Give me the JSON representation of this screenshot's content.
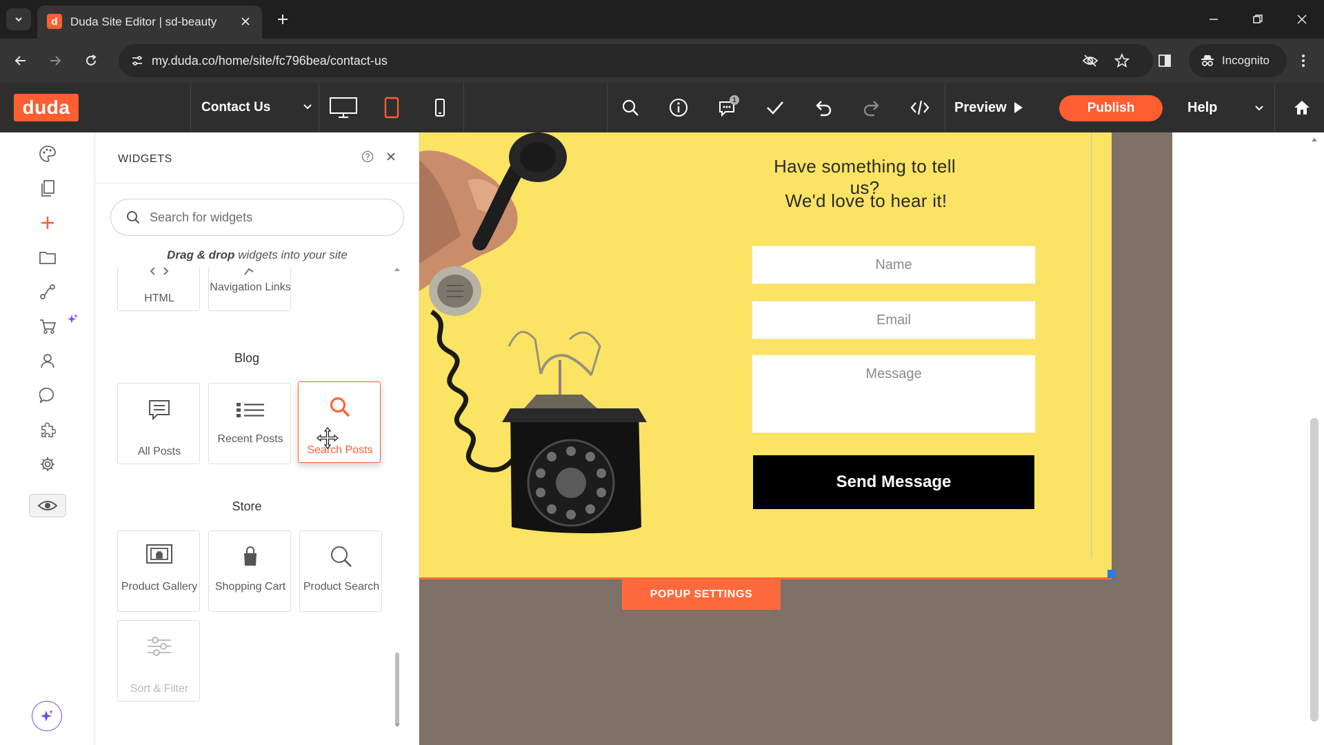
{
  "browser": {
    "tab_title": "Duda Site Editor | sd-beauty",
    "favicon_letter": "d",
    "url": "my.duda.co/home/site/fc796bea/contact-us",
    "profile_label": "Incognito",
    "icons": [
      "tab-list-icon",
      "close-icon",
      "plus-icon",
      "minimize-icon",
      "restore-icon",
      "close-window-icon",
      "back-icon",
      "forward-icon",
      "reload-icon",
      "site-info-icon",
      "eye-off-icon",
      "star-icon",
      "side-panel-icon",
      "incognito-icon",
      "more-vert-icon"
    ]
  },
  "toolbar": {
    "logo": "duda",
    "page_name": "Contact Us",
    "preview_label": "Preview",
    "publish_label": "Publish",
    "help_label": "Help",
    "notification_count": "1",
    "accent_color": "#ff5e31"
  },
  "rail": {
    "icons": [
      "palette-icon",
      "pages-icon",
      "add-icon",
      "folder-icon",
      "flow-icon",
      "cart-icon",
      "user-icon",
      "chat-icon",
      "puzzle-icon",
      "gear-icon",
      "eye-icon",
      "ai-assistant-icon"
    ]
  },
  "panel": {
    "title": "WIDGETS",
    "search_placeholder": "Search for widgets",
    "dragdrop_bold": "Drag & drop",
    "dragdrop_rest": " widgets into your site",
    "top_items": [
      {
        "label": "HTML",
        "icon": "html-icon"
      },
      {
        "label": "Navigation Links",
        "icon": "navigation-links-icon"
      }
    ],
    "sections": [
      {
        "name": "Blog",
        "items": [
          {
            "label": "All Posts",
            "icon": "all-posts-icon"
          },
          {
            "label": "Recent Posts",
            "icon": "recent-posts-icon"
          },
          {
            "label": "Search Posts",
            "icon": "search-posts-icon",
            "state": "hover"
          }
        ]
      },
      {
        "name": "Store",
        "items": [
          {
            "label": "Product Gallery",
            "icon": "product-gallery-icon"
          },
          {
            "label": "Shopping Cart",
            "icon": "shopping-cart-icon"
          },
          {
            "label": "Product Search",
            "icon": "product-search-icon"
          },
          {
            "label": "Sort & Filter",
            "icon": "sort-filter-icon",
            "state": "disabled"
          }
        ]
      }
    ]
  },
  "canvas": {
    "heading_line1": "Have something to tell us?",
    "heading_line2": "We'd love to hear it!",
    "name_placeholder": "Name",
    "email_placeholder": "Email",
    "message_placeholder": "Message",
    "send_label": "Send Message",
    "popup_settings_label": "POPUP SETTINGS",
    "popup_color": "#fbe364",
    "backdrop_color": "#7f7068"
  }
}
